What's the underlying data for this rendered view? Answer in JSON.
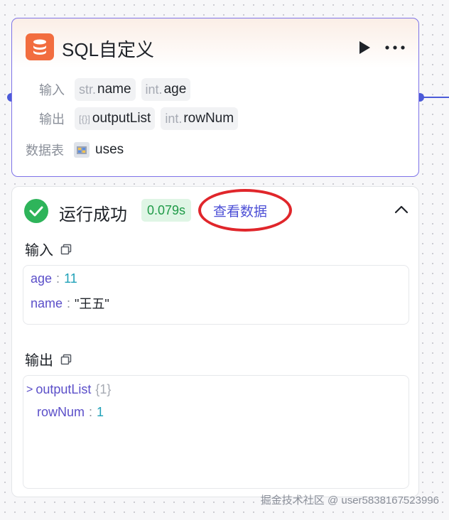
{
  "node": {
    "title": "SQL自定义",
    "input_label": "输入",
    "inputs": [
      {
        "type": "str.",
        "name": "name"
      },
      {
        "type": "int.",
        "name": "age"
      }
    ],
    "output_label": "输出",
    "outputs": [
      {
        "type": "[{}]",
        "name": "outputList"
      },
      {
        "type": "int.",
        "name": "rowNum"
      }
    ],
    "table_label": "数据表",
    "table_name": "uses"
  },
  "result": {
    "status": "运行成功",
    "duration": "0.079s",
    "view_data_link": "查看数据",
    "input_title": "输入",
    "input_rows": [
      {
        "key": "age",
        "sep": ":",
        "value": "11"
      },
      {
        "key": "name",
        "sep": ":",
        "value": "\"王五\""
      }
    ],
    "output_title": "输出",
    "output_rows": [
      {
        "expander": ">",
        "key": "outputList",
        "count": "{1}"
      },
      {
        "key": "rowNum",
        "sep": ":",
        "value": "1"
      }
    ]
  },
  "watermark": "掘金技术社区 @ user5838167523996",
  "colors": {
    "accent": "#4c5bd9",
    "node_border": "#7e73e8",
    "success": "#2eb45a",
    "annotation": "#e0262b",
    "icon_orange": "#f26d3f"
  }
}
